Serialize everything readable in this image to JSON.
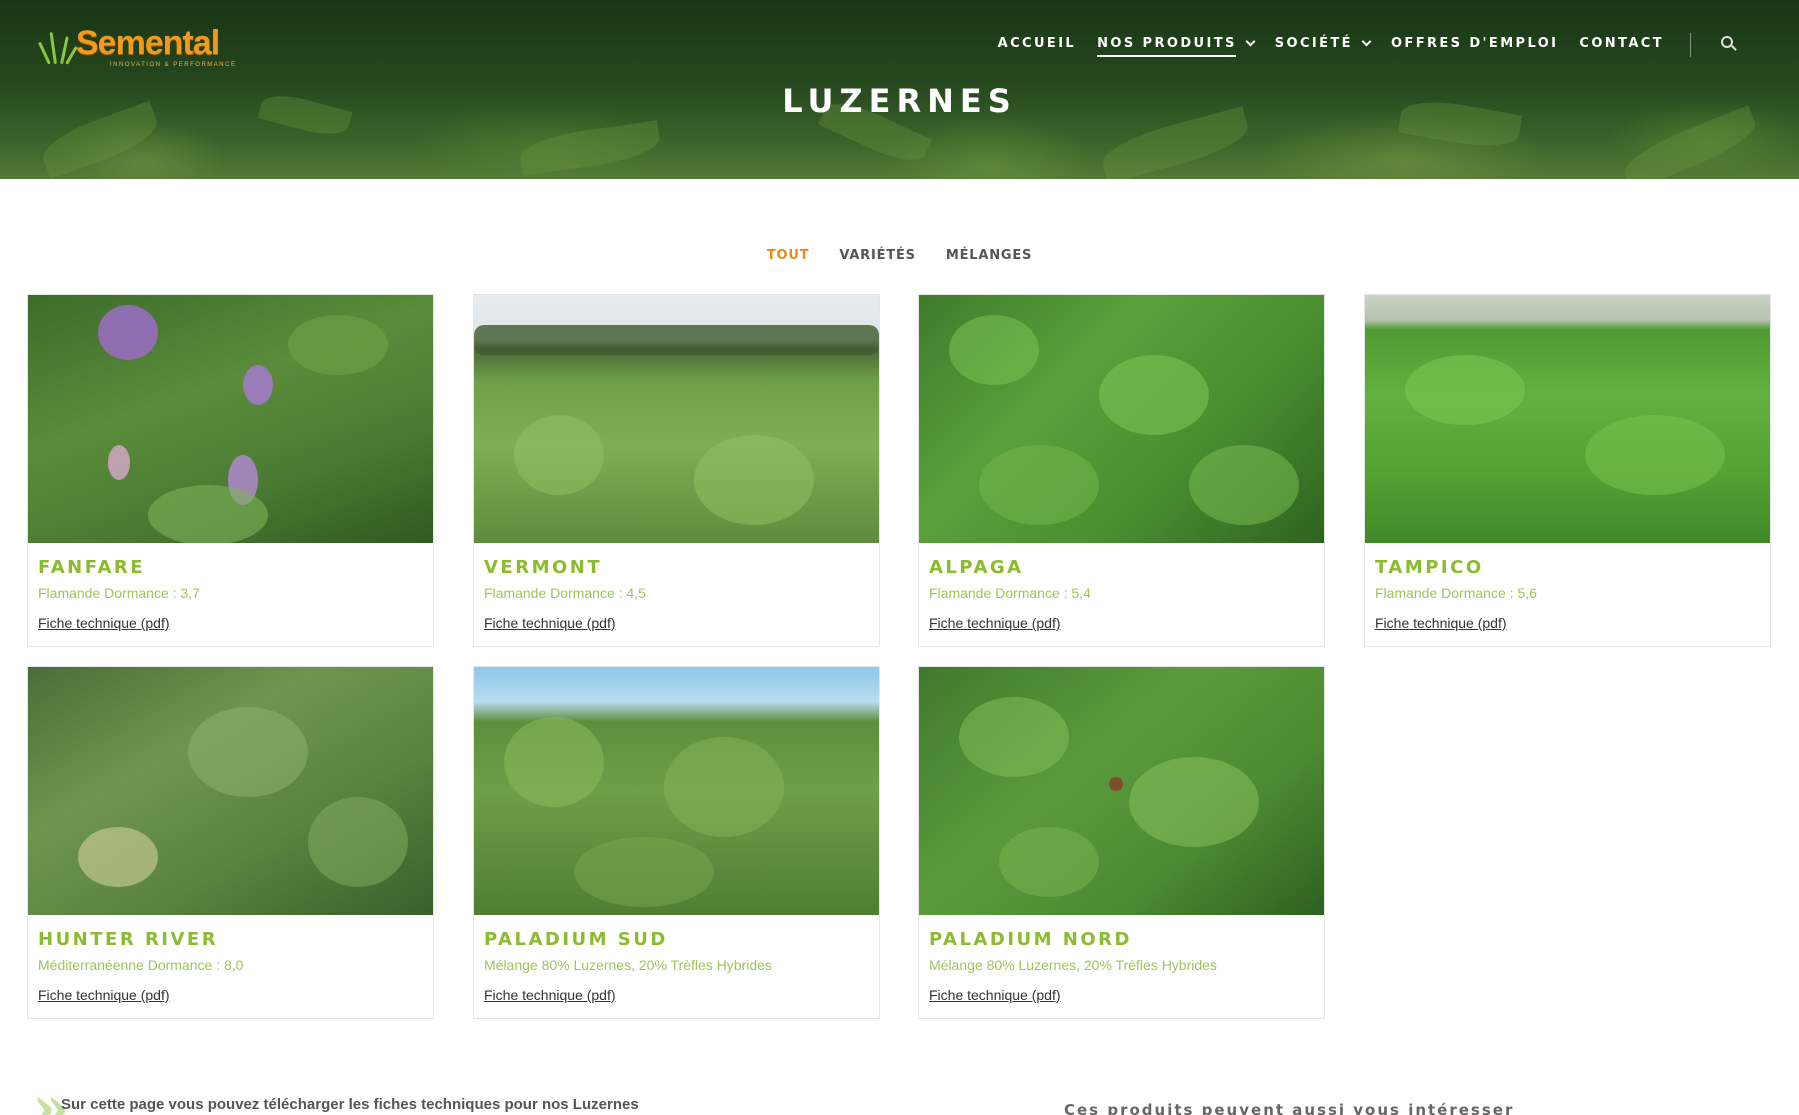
{
  "brand": {
    "name": "Semental",
    "tagline": "INNOVATION & PERFORMANCE",
    "accent": "#f39a1e",
    "green": "#8dbb2f"
  },
  "nav": {
    "items": [
      {
        "label": "ACCUEIL",
        "active": false,
        "dropdown": false
      },
      {
        "label": "NOS PRODUITS",
        "active": true,
        "dropdown": true
      },
      {
        "label": "SOCIÉTÉ",
        "active": false,
        "dropdown": true
      },
      {
        "label": "OFFRES D'EMPLOI",
        "active": false,
        "dropdown": false
      },
      {
        "label": "CONTACT",
        "active": false,
        "dropdown": false
      }
    ],
    "search_icon": "search-icon"
  },
  "page": {
    "title": "LUZERNES"
  },
  "filters": [
    {
      "label": "TOUT",
      "active": true
    },
    {
      "label": "VARIÉTÉS",
      "active": false
    },
    {
      "label": "MÉLANGES",
      "active": false
    }
  ],
  "products": [
    {
      "name": "FANFARE",
      "desc": "Flamande Dormance : 3,7",
      "link": "Fiche technique (pdf)"
    },
    {
      "name": "VERMONT",
      "desc": "Flamande Dormance : 4,5",
      "link": "Fiche technique (pdf)"
    },
    {
      "name": "ALPAGA",
      "desc": "Flamande Dormance : 5,4",
      "link": "Fiche technique (pdf)"
    },
    {
      "name": "TAMPICO",
      "desc": "Flamande Dormance : 5,6",
      "link": "Fiche technique (pdf)"
    },
    {
      "name": "HUNTER RIVER",
      "desc": "Méditerranéenne Dormance : 8,0",
      "link": "Fiche technique (pdf)"
    },
    {
      "name": "PALADIUM SUD",
      "desc": "Mélange 80% Luzernes, 20% Trèfles Hybrides",
      "link": "Fiche technique (pdf)"
    },
    {
      "name": "PALADIUM NORD",
      "desc": "Mélange 80% Luzernes, 20% Trèfles Hybrides",
      "link": "Fiche technique (pdf)"
    }
  ],
  "footer": {
    "intro": "Sur cette page vous pouvez télécharger les fiches techniques pour nos Luzernes",
    "also": "Ces produits peuvent aussi vous intéresser"
  }
}
